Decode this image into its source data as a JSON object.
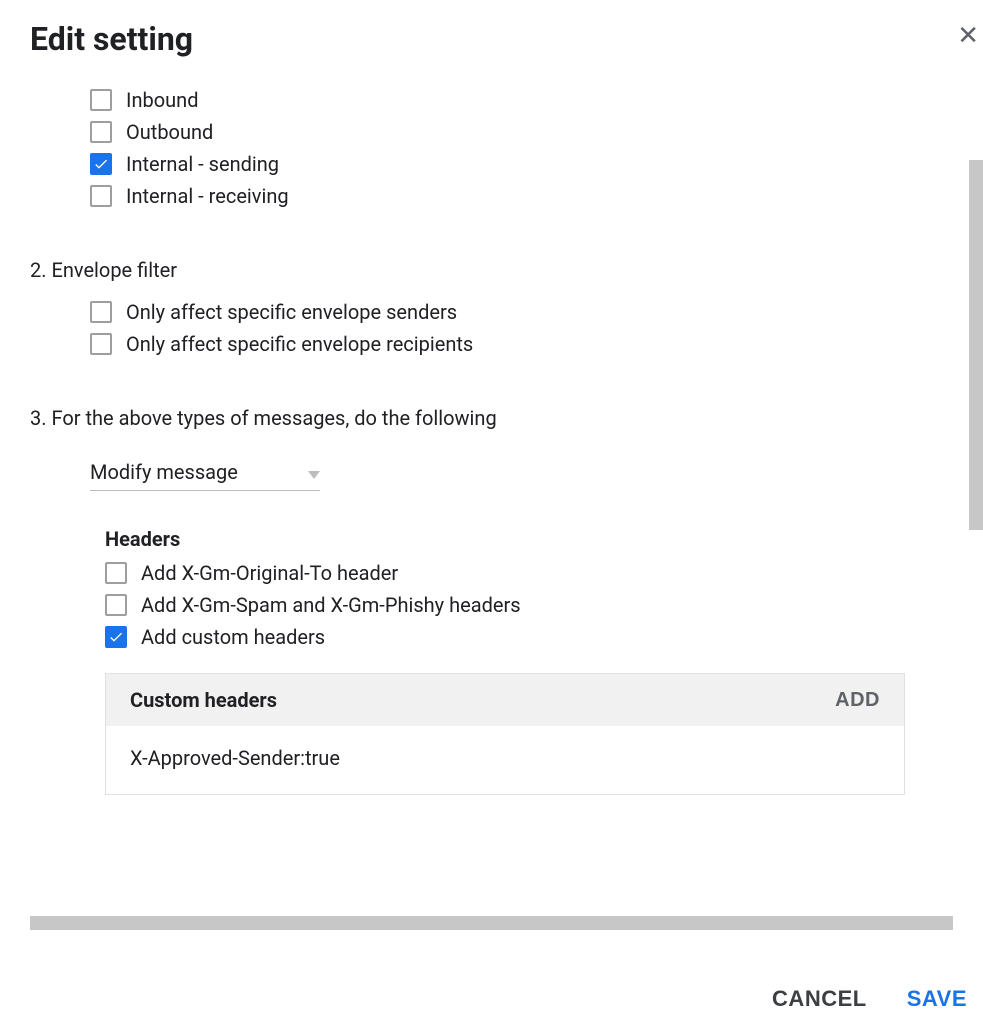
{
  "dialog": {
    "title": "Edit setting"
  },
  "section1": {
    "options": [
      {
        "label": "Inbound",
        "checked": false
      },
      {
        "label": "Outbound",
        "checked": false
      },
      {
        "label": "Internal - sending",
        "checked": true
      },
      {
        "label": "Internal - receiving",
        "checked": false
      }
    ]
  },
  "section2": {
    "title": "2. Envelope filter",
    "options": [
      {
        "label": "Only affect specific envelope senders",
        "checked": false
      },
      {
        "label": "Only affect specific envelope recipients",
        "checked": false
      }
    ]
  },
  "section3": {
    "title": "3. For the above types of messages, do the following",
    "select_value": "Modify message",
    "headers_subheading": "Headers",
    "header_options": [
      {
        "label": "Add X-Gm-Original-To header",
        "checked": false
      },
      {
        "label": "Add X-Gm-Spam and X-Gm-Phishy headers",
        "checked": false
      },
      {
        "label": "Add custom headers",
        "checked": true
      }
    ],
    "custom_headers": {
      "title": "Custom headers",
      "add_label": "ADD",
      "items": [
        "X-Approved-Sender:true"
      ]
    }
  },
  "footer": {
    "cancel": "CANCEL",
    "save": "SAVE"
  }
}
